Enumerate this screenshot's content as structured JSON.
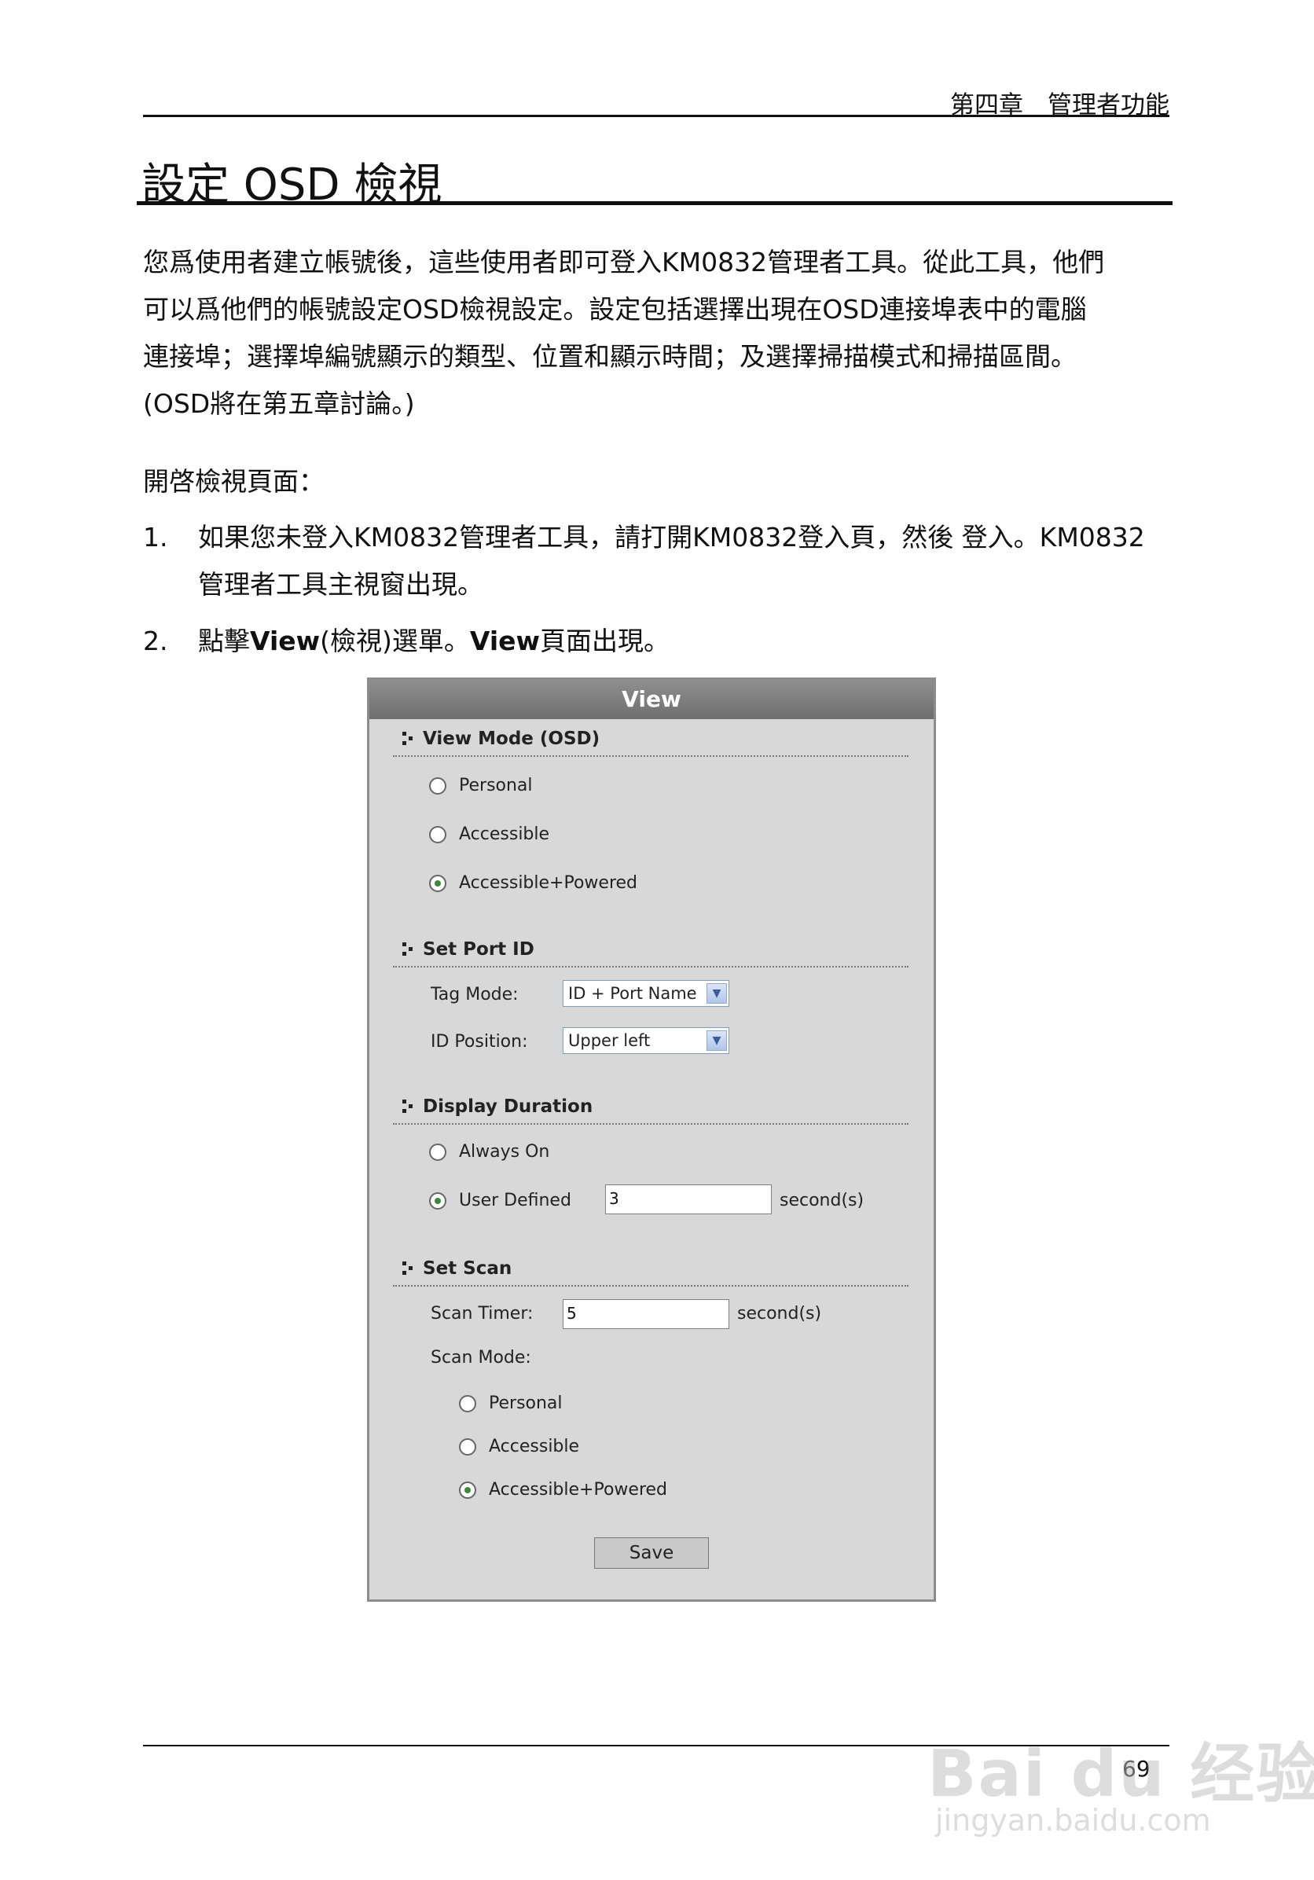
{
  "header": {
    "chapter": "第四章　管理者功能"
  },
  "title": "設定 OSD 檢視",
  "intro": {
    "lines": [
      "您爲使用者建立帳號後，這些使用者即可登入KM0832管理者工具。從此工具，他們",
      "可以爲他們的帳號設定OSD檢視設定。設定包括選擇出現在OSD連接埠表中的電腦",
      "連接埠；選擇埠編號顯示的類型、位置和顯示時間；及選擇掃描模式和掃描區間。",
      "(OSD將在第五章討論。)"
    ]
  },
  "open_label": "開啓檢視頁面：",
  "steps": [
    {
      "num": "1.",
      "line1": "如果您未登入KM0832管理者工具，請打開KM0832登入頁，然後 登入。KM0832",
      "line2": "管理者工具主視窗出現。"
    },
    {
      "num": "2.",
      "pre": "點擊",
      "bold1": "View",
      "mid": "(檢視)選單。",
      "bold2": "View",
      "post": "頁面出現。"
    }
  ],
  "panel": {
    "title": "View",
    "view_mode": {
      "heading": "View Mode (OSD)",
      "options": [
        "Personal",
        "Accessible",
        "Accessible+Powered"
      ],
      "selected": "Accessible+Powered"
    },
    "port_id": {
      "heading": "Set Port ID",
      "tag_mode_label": "Tag Mode:",
      "tag_mode_value": "ID + Port Name",
      "id_position_label": "ID Position:",
      "id_position_value": "Upper left"
    },
    "duration": {
      "heading": "Display Duration",
      "always_on": "Always On",
      "user_defined": "User Defined",
      "selected": "User Defined",
      "value": "3",
      "unit": "second(s)"
    },
    "scan": {
      "heading": "Set Scan",
      "timer_label": "Scan Timer:",
      "timer_value": "5",
      "timer_unit": "second(s)",
      "mode_label": "Scan Mode:",
      "options": [
        "Personal",
        "Accessible",
        "Accessible+Powered"
      ],
      "selected": "Accessible+Powered"
    },
    "save_label": "Save"
  },
  "footer": {
    "page_number": "69"
  },
  "watermark": {
    "brand": "Bai du 经验",
    "url": "jingyan.baidu.com"
  }
}
